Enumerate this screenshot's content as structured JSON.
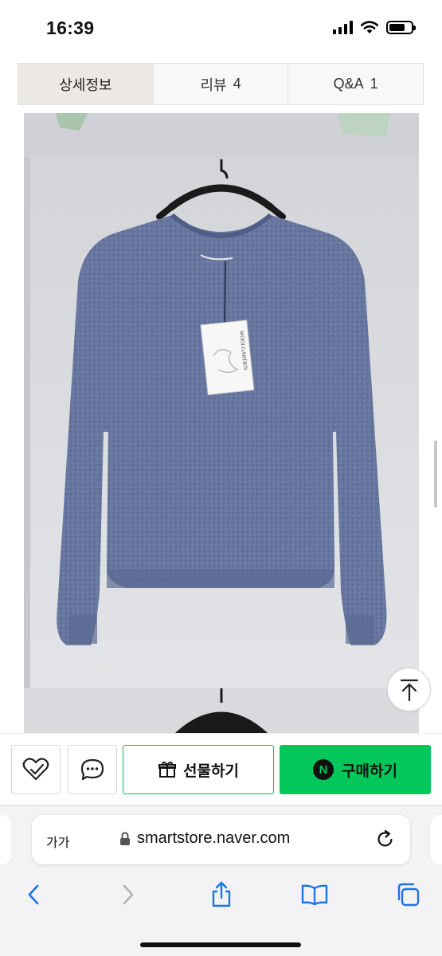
{
  "status_bar": {
    "time": "16:39",
    "icons": [
      "signal-icon",
      "wifi-icon",
      "battery-icon"
    ]
  },
  "tabs": [
    {
      "label": "상세정보",
      "count": "",
      "active": true
    },
    {
      "label": "리뷰",
      "count": "4",
      "active": false
    },
    {
      "label": "Q&A",
      "count": "1",
      "active": false
    }
  ],
  "product_image": {
    "description_icon": "product-photo",
    "hang_tag_text": "WOOLGARDEN"
  },
  "purchase_bar": {
    "wish_icon": "heart-check-icon",
    "talk_icon": "chat-bubble-icon",
    "gift_label": "선물하기",
    "gift_icon": "gift-icon",
    "buy_label": "구매하기",
    "buy_badge": "N",
    "accent_color": "#03c75a"
  },
  "browser": {
    "text_size_label": "가가",
    "url": "smartstore.naver.com",
    "lock_icon": "lock-icon",
    "reload_icon": "reload-icon",
    "toolbar": [
      "back-icon",
      "forward-icon",
      "share-icon",
      "bookmarks-icon",
      "tabs-icon"
    ]
  }
}
